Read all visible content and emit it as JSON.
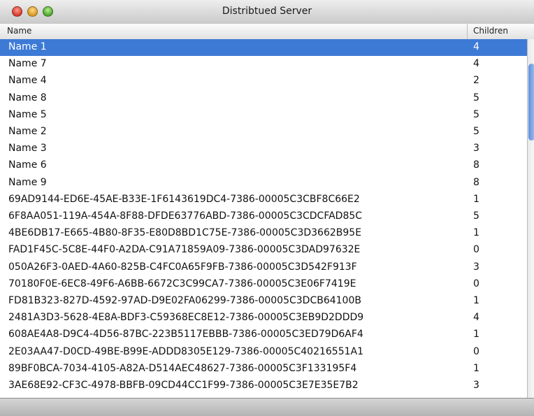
{
  "window": {
    "title": "Distribtued Server"
  },
  "table": {
    "columns": {
      "name": "Name",
      "children": "Children"
    },
    "rows": [
      {
        "name": "Name 1",
        "children": "4"
      },
      {
        "name": "Name 7",
        "children": "4"
      },
      {
        "name": "Name 4",
        "children": "2"
      },
      {
        "name": "Name 8",
        "children": "5"
      },
      {
        "name": "Name 5",
        "children": "5"
      },
      {
        "name": "Name 2",
        "children": "5"
      },
      {
        "name": "Name 3",
        "children": "3"
      },
      {
        "name": "Name 6",
        "children": "8"
      },
      {
        "name": "Name 9",
        "children": "8"
      },
      {
        "name": "69AD9144-ED6E-45AE-B33E-1F6143619DC4-7386-00005C3CBF8C66E2",
        "children": "1"
      },
      {
        "name": "6F8AA051-119A-454A-8F88-DFDE63776ABD-7386-00005C3CDCFAD85C",
        "children": "5"
      },
      {
        "name": "4BE6DB17-E665-4B80-8F35-E80D8BD1C75E-7386-00005C3D3662B95E",
        "children": "1"
      },
      {
        "name": "FAD1F45C-5C8E-44F0-A2DA-C91A71859A09-7386-00005C3DAD97632E",
        "children": "0"
      },
      {
        "name": "050A26F3-0AED-4A60-825B-C4FC0A65F9FB-7386-00005C3D542F913F",
        "children": "3"
      },
      {
        "name": "70180F0E-6EC8-49F6-A6BB-6672C3C99CA7-7386-00005C3E06F7419E",
        "children": "0"
      },
      {
        "name": "FD81B323-827D-4592-97AD-D9E02FA06299-7386-00005C3DCB64100B",
        "children": "1"
      },
      {
        "name": "2481A3D3-5628-4E8A-BDF3-C59368EC8E12-7386-00005C3EB9D2DDD9",
        "children": "4"
      },
      {
        "name": "608AE4A8-D9C4-4D56-87BC-223B5117EBBB-7386-00005C3ED79D6AF4",
        "children": "1"
      },
      {
        "name": "2E03AA47-D0CD-49BE-B99E-ADDD8305E129-7386-00005C40216551A1",
        "children": "0"
      },
      {
        "name": "89BF0BCA-7034-4105-A82A-D514AEC48627-7386-00005C3F133195F4",
        "children": "1"
      },
      {
        "name": "3AE68E92-CF3C-4978-BBFB-09CD44CC1F99-7386-00005C3E7E35E7B2",
        "children": "3"
      }
    ]
  },
  "colors": {
    "selection": "#3d7ad6",
    "selected_text": "#ffffff"
  }
}
